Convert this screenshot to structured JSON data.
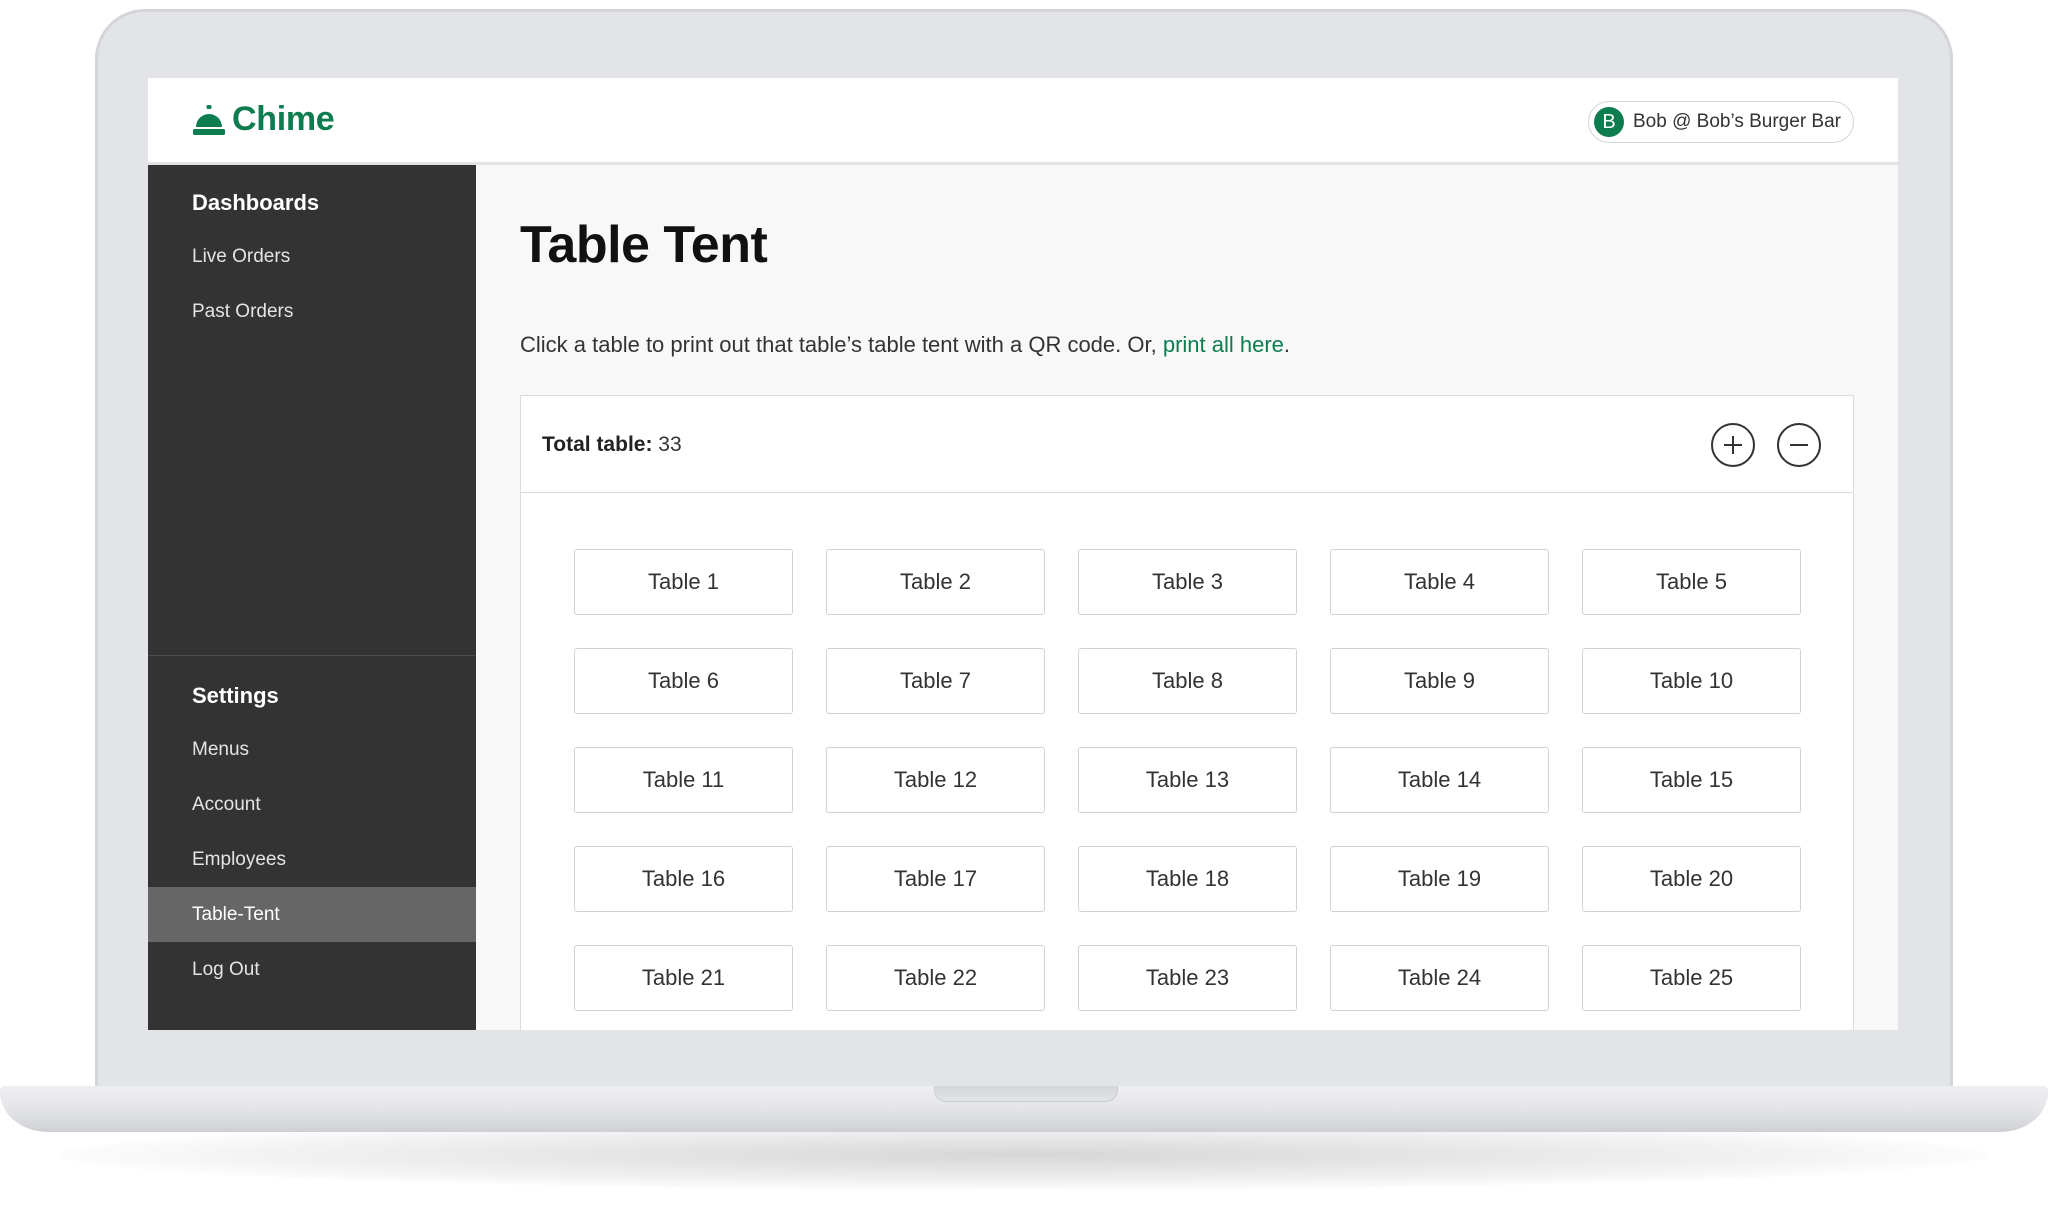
{
  "app": {
    "brand": "Chime",
    "brand_color": "#0d7c4e"
  },
  "user": {
    "initial": "B",
    "label": "Bob @ Bob’s Burger Bar"
  },
  "sidebar": {
    "dashboards_heading": "Dashboards",
    "dashboards_items": [
      {
        "label": "Live Orders"
      },
      {
        "label": "Past Orders"
      }
    ],
    "settings_heading": "Settings",
    "settings_items": [
      {
        "label": "Menus"
      },
      {
        "label": "Account"
      },
      {
        "label": "Employees"
      },
      {
        "label": "Table-Tent",
        "active": true
      },
      {
        "label": "Log Out"
      }
    ]
  },
  "main": {
    "title": "Table Tent",
    "intro_text": "Click a table to print out that table’s table tent with a QR code. Or, ",
    "intro_link": "print all here",
    "intro_end": ".",
    "total_label": "Total table:",
    "total_value": "33",
    "add_icon": "plus-icon",
    "remove_icon": "minus-icon",
    "tables": [
      "Table 1",
      "Table 2",
      "Table 3",
      "Table 4",
      "Table 5",
      "Table 6",
      "Table 7",
      "Table 8",
      "Table 9",
      "Table 10",
      "Table 11",
      "Table 12",
      "Table 13",
      "Table 14",
      "Table 15",
      "Table 16",
      "Table 17",
      "Table 18",
      "Table 19",
      "Table 20",
      "Table 21",
      "Table 22",
      "Table 23",
      "Table 24",
      "Table 25"
    ]
  }
}
